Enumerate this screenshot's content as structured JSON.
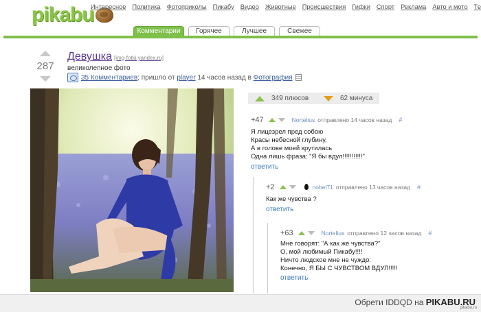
{
  "site": {
    "logo_text": "pikabu",
    "brand_color": "#7ec04a"
  },
  "nav": [
    "Интересное",
    "Политика",
    "Фотоприколы",
    "Пикабу",
    "Видео",
    "Животные",
    "Происшествия",
    "Гифки",
    "Спорт",
    "Реклама",
    "Авто и мото",
    "Те"
  ],
  "tabs": [
    "Комментарии",
    "Горячее",
    "Лучшее",
    "Свежее"
  ],
  "post": {
    "rating": "287",
    "title": "Девушка",
    "source": "[img-fotki.yandex.ru]",
    "description": "великолепное фото",
    "comments_link": "35 Комментариев",
    "meta_mid": "; пришло от",
    "author": "player",
    "meta_time": "14 часов назад в",
    "category": "Фотография"
  },
  "votes": {
    "plus": "349 плюсов",
    "minus": "62 минуса"
  },
  "comments": [
    {
      "score": "+47",
      "author": "Nortelius",
      "meta": "отправлено 14 часов назад",
      "hash": "#",
      "lines": [
        "Я лицезрел пред собою",
        "Красы небесной глубину,",
        "А в голове моей крутилась",
        "Одна лишь фраза: \"Я бы вдул!!!!!!!!!!!\""
      ],
      "reply": "ответить"
    },
    {
      "score": "+2",
      "author": "nobel71",
      "meta": "отправлено 13 часов назад",
      "hash": "#",
      "lines": [
        "Как же чувства ?"
      ],
      "reply": "ответить"
    },
    {
      "score": "+63",
      "author": "Nortelius",
      "meta": "отправлено 12 часов назад",
      "hash": "#",
      "lines": [
        "Мне говорят: \"А как же чувства?\"",
        "О, мой любимый Пикабу!!!!",
        "Ничто людское мне не чуждо:",
        "Конечно, Я БЫ С ЧУВСТВОМ ВДУЛ!!!!!"
      ],
      "reply": "ответить"
    }
  ],
  "footer": {
    "prefix": "Обрети IDDQD на",
    "site": "PIKABU.RU",
    "watermark": "pikabu.ru"
  }
}
